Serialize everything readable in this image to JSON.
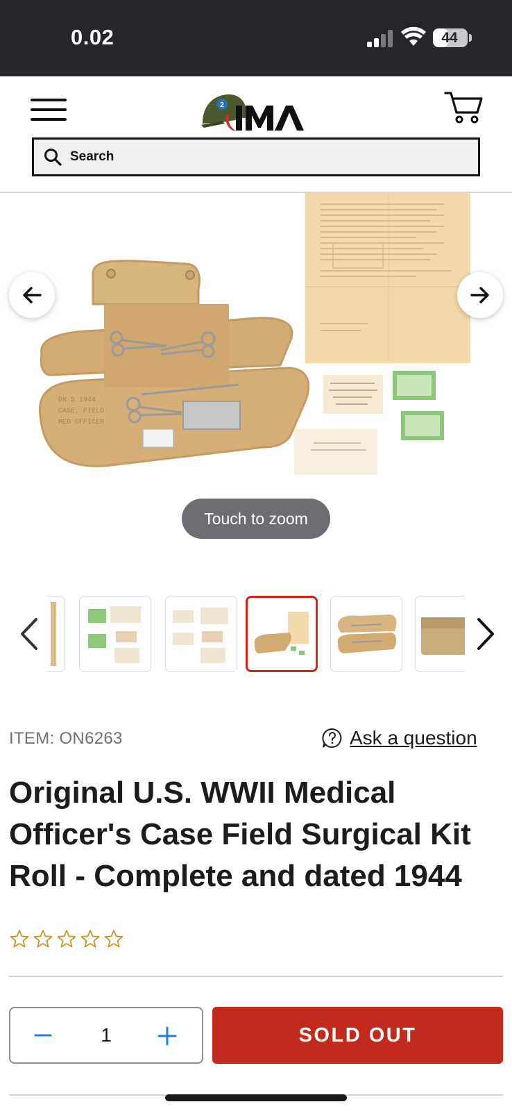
{
  "status_bar": {
    "time": "0.02",
    "battery": "44",
    "battery_level": 0.44,
    "signal_bars_active": 2,
    "signal_bars_total": 4
  },
  "header": {
    "menu_icon": "hamburger-menu-icon",
    "logo_text": "IMA",
    "cart_icon": "shopping-cart-icon",
    "search": {
      "placeholder": "Search",
      "value": ""
    }
  },
  "gallery": {
    "zoom_hint": "Touch to zoom",
    "prev_icon": "arrow-left-icon",
    "next_icon": "arrow-right-icon",
    "thumbnails_total": 6,
    "thumbnail_active_index": 3
  },
  "product": {
    "item_code": "ITEM: ON6263",
    "ask_question": "Ask a question",
    "title": "Original U.S. WWII Medical Officer's Case Field Surgical Kit Roll - Complete and dated 1944",
    "rating": 0,
    "rating_max": 5,
    "quantity": "1",
    "sold_out_label": "SOLD OUT"
  },
  "colors": {
    "brand_red": "#c22a1e",
    "status_bar": "#25262b",
    "star_gold": "#c9962e",
    "accent_blue": "#1f7fd6"
  }
}
